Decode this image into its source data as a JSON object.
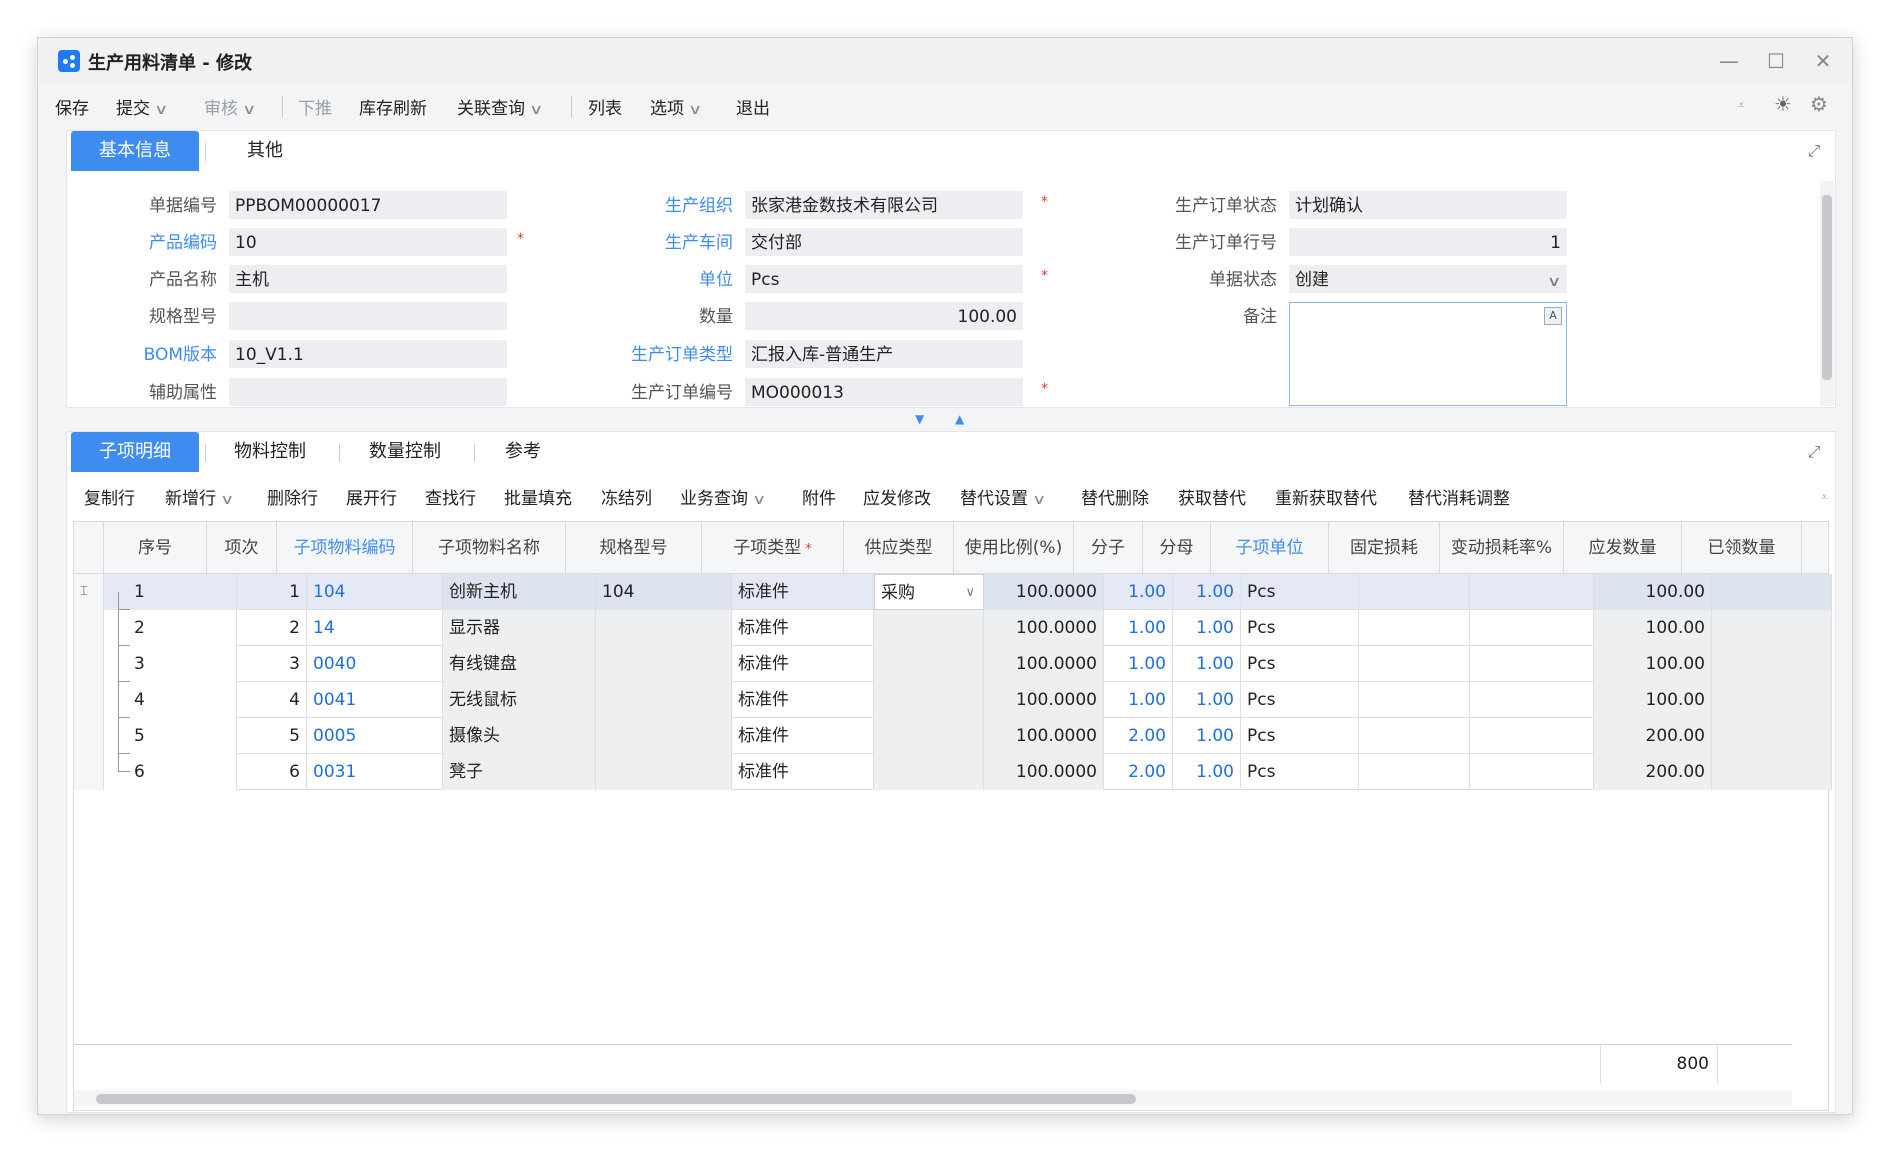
{
  "window": {
    "title": "生产用料清单 - 修改"
  },
  "toolbar": {
    "save": "保存",
    "submit": "提交",
    "audit": "审核",
    "push_down": "下推",
    "stock_refresh": "库存刷新",
    "related_query": "关联查询",
    "list": "列表",
    "options": "选项",
    "exit": "退出"
  },
  "header_tabs": {
    "basic": "基本信息",
    "other": "其他"
  },
  "header": {
    "doc_no": {
      "label": "单据编号",
      "value": "PPBOM00000017"
    },
    "product_code": {
      "label": "产品编码",
      "value": "10"
    },
    "product_name": {
      "label": "产品名称",
      "value": "主机"
    },
    "spec": {
      "label": "规格型号",
      "value": ""
    },
    "bom_version": {
      "label": "BOM版本",
      "value": "10_V1.1"
    },
    "aux_attr": {
      "label": "辅助属性",
      "value": ""
    },
    "prod_org": {
      "label": "生产组织",
      "value": "张家港金数技术有限公司"
    },
    "workshop": {
      "label": "生产车间",
      "value": "交付部"
    },
    "unit": {
      "label": "单位",
      "value": "Pcs"
    },
    "qty": {
      "label": "数量",
      "value": "100.00"
    },
    "order_type": {
      "label": "生产订单类型",
      "value": "汇报入库-普通生产"
    },
    "order_no": {
      "label": "生产订单编号",
      "value": "MO000013"
    },
    "order_status": {
      "label": "生产订单状态",
      "value": "计划确认"
    },
    "order_line": {
      "label": "生产订单行号",
      "value": "1"
    },
    "doc_status": {
      "label": "单据状态",
      "value": "创建"
    },
    "remark": {
      "label": "备注",
      "value": ""
    },
    "required_mark": "*"
  },
  "detail_tabs": {
    "items": "子项明细",
    "material_ctrl": "物料控制",
    "qty_ctrl": "数量控制",
    "reference": "参考"
  },
  "detail_toolbar": {
    "copy_row": "复制行",
    "add_row": "新增行",
    "delete_row": "删除行",
    "expand_row": "展开行",
    "find_row": "查找行",
    "batch_fill": "批量填充",
    "freeze_col": "冻结列",
    "biz_query": "业务查询",
    "attachment": "附件",
    "issue_modify": "应发修改",
    "sub_settings": "替代设置",
    "sub_delete": "替代删除",
    "get_sub": "获取替代",
    "reget_sub": "重新获取替代",
    "sub_loss_adjust": "替代消耗调整"
  },
  "grid": {
    "columns": [
      "序号",
      "项次",
      "子项物料编码",
      "子项物料名称",
      "规格型号",
      "子项类型",
      "供应类型",
      "使用比例(%)",
      "分子",
      "分母",
      "子项单位",
      "固定损耗",
      "变动损耗率%",
      "应发数量",
      "已领数量"
    ],
    "rows": [
      {
        "seq": "1",
        "item": "1",
        "code": "104",
        "name": "创新主机",
        "spec": "104",
        "type": "标准件",
        "supply": "采购",
        "ratio": "100.0000",
        "num": "1.00",
        "den": "1.00",
        "unit": "Pcs",
        "issue_qty": "100.00"
      },
      {
        "seq": "2",
        "item": "2",
        "code": "14",
        "name": "显示器",
        "spec": "",
        "type": "标准件",
        "supply": "",
        "ratio": "100.0000",
        "num": "1.00",
        "den": "1.00",
        "unit": "Pcs",
        "issue_qty": "100.00"
      },
      {
        "seq": "3",
        "item": "3",
        "code": "0040",
        "name": "有线键盘",
        "spec": "",
        "type": "标准件",
        "supply": "",
        "ratio": "100.0000",
        "num": "1.00",
        "den": "1.00",
        "unit": "Pcs",
        "issue_qty": "100.00"
      },
      {
        "seq": "4",
        "item": "4",
        "code": "0041",
        "name": "无线鼠标",
        "spec": "",
        "type": "标准件",
        "supply": "",
        "ratio": "100.0000",
        "num": "1.00",
        "den": "1.00",
        "unit": "Pcs",
        "issue_qty": "100.00"
      },
      {
        "seq": "5",
        "item": "5",
        "code": "0005",
        "name": "摄像头",
        "spec": "",
        "type": "标准件",
        "supply": "",
        "ratio": "100.0000",
        "num": "2.00",
        "den": "1.00",
        "unit": "Pcs",
        "issue_qty": "200.00"
      },
      {
        "seq": "6",
        "item": "6",
        "code": "0031",
        "name": "凳子",
        "spec": "",
        "type": "标准件",
        "supply": "",
        "ratio": "100.0000",
        "num": "2.00",
        "den": "1.00",
        "unit": "Pcs",
        "issue_qty": "200.00"
      }
    ],
    "total_issue_qty": "800"
  },
  "colors": {
    "accent": "#3f8cf0",
    "required": "#e53935",
    "link": "#1f6fe0"
  }
}
